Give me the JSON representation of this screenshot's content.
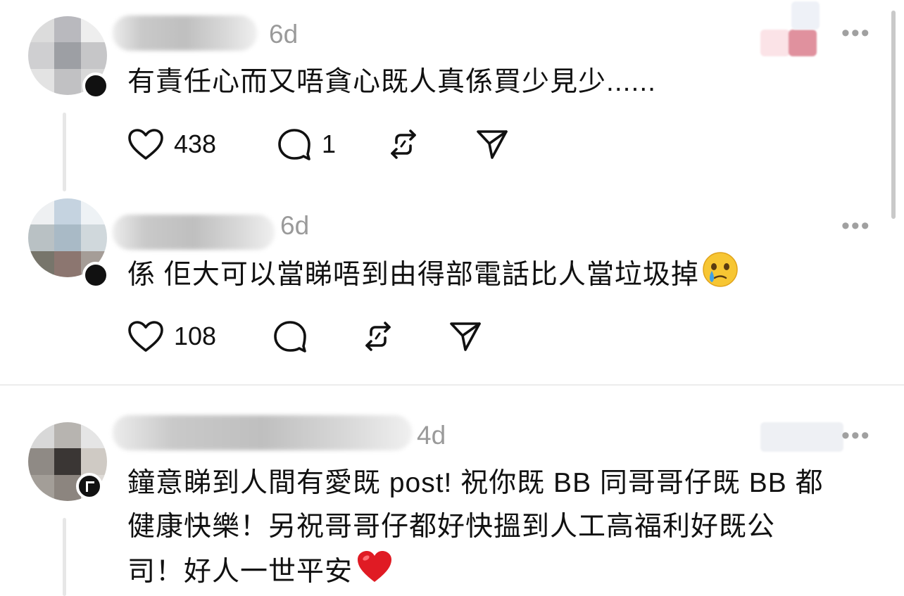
{
  "comments": [
    {
      "time": "6d",
      "text": "有責任心而又唔貪心既人真係買少見少......",
      "likes": "438",
      "replies": "1",
      "more": "•••"
    },
    {
      "time": "6d",
      "text": "係 佢大可以當睇唔到由得部電話比人當垃圾掉",
      "emoji": "face-holding-back-tears",
      "likes": "108",
      "replies": "",
      "more": "•••"
    },
    {
      "time": "4d",
      "text_lines": [
        "鐘意睇到人間有愛既 post! 祝你既 BB 同哥哥仔既 BB 都",
        "健康快樂！另祝哥哥仔都好快搵到人工高福利好既公",
        "司！好人一世平安"
      ],
      "emoji": "red-heart",
      "more": "•••"
    }
  ],
  "icons": {
    "like": "heart-outline-icon",
    "reply": "speech-bubble-icon",
    "repost": "repost-icon",
    "share": "paper-plane-icon"
  },
  "colors": {
    "text": "#101010",
    "meta": "#9a9a9a",
    "divider": "#ececec",
    "heart": "#e0245e"
  }
}
